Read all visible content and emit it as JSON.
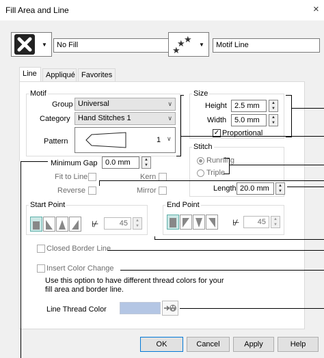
{
  "window": {
    "title": "Fill Area and Line",
    "close": "×"
  },
  "top": {
    "fill_name": "No Fill",
    "line_name": "Motif Line"
  },
  "tabs": [
    {
      "label": "Line"
    },
    {
      "label": "Appliqué"
    },
    {
      "label": "Favorites"
    }
  ],
  "motif": {
    "title": "Motif",
    "group_label": "Group",
    "group_value": "Universal",
    "category_label": "Category",
    "category_value": "Hand Stitches 1",
    "pattern_label": "Pattern",
    "pattern_number": "1"
  },
  "size": {
    "title": "Size",
    "height_label": "Height",
    "height_value": "2.5 mm",
    "width_label": "Width",
    "width_value": "5.0 mm",
    "proportional_label": "Proportional",
    "proportional_checked": true
  },
  "stitch": {
    "title": "Stitch",
    "running_label": "Running",
    "triple_label": "Triple",
    "selected": "Running",
    "length_label": "Length",
    "length_value": "20.0 mm"
  },
  "options": {
    "min_gap_label": "Minimum Gap",
    "min_gap_value": "0.0 mm",
    "fit_label": "Fit to Line",
    "kern_label": "Kern",
    "reverse_label": "Reverse",
    "mirror_label": "Mirror"
  },
  "start_point": {
    "title": "Start Point",
    "angle": "45"
  },
  "end_point": {
    "title": "End Point",
    "angle": "45"
  },
  "border": {
    "closed_label": "Closed Border Line",
    "insert_label": "Insert Color Change"
  },
  "info": {
    "line1": "Use this option to have different thread colors for your",
    "line2": "fill area and border line."
  },
  "thread": {
    "label": "Line Thread Color",
    "color": "#b4c6e4"
  },
  "buttons": {
    "ok": "OK",
    "cancel": "Cancel",
    "apply": "Apply",
    "help": "Help"
  }
}
